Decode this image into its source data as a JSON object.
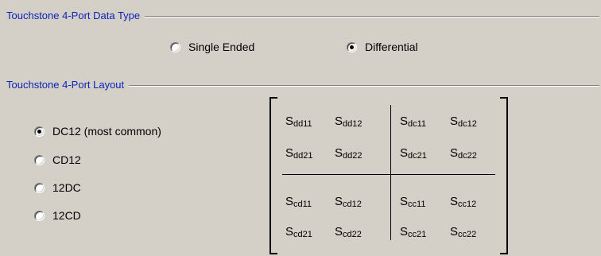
{
  "data_type_group": {
    "title": "Touchstone 4-Port Data Type",
    "options": [
      {
        "label": "Single Ended",
        "selected": false
      },
      {
        "label": "Differential",
        "selected": true
      }
    ]
  },
  "layout_group": {
    "title": "Touchstone 4-Port Layout",
    "options": [
      {
        "label": "DC12 (most common)",
        "selected": true
      },
      {
        "label": "CD12",
        "selected": false
      },
      {
        "label": "12DC",
        "selected": false
      },
      {
        "label": "12CD",
        "selected": false
      }
    ]
  },
  "matrix": {
    "symbol": "S",
    "rows": [
      [
        "dd11",
        "dd12",
        "dc11",
        "dc12"
      ],
      [
        "dd21",
        "dd22",
        "dc21",
        "dc22"
      ],
      [
        "cd11",
        "cd12",
        "cc11",
        "cc12"
      ],
      [
        "cd21",
        "cd22",
        "cc21",
        "cc22"
      ]
    ]
  }
}
